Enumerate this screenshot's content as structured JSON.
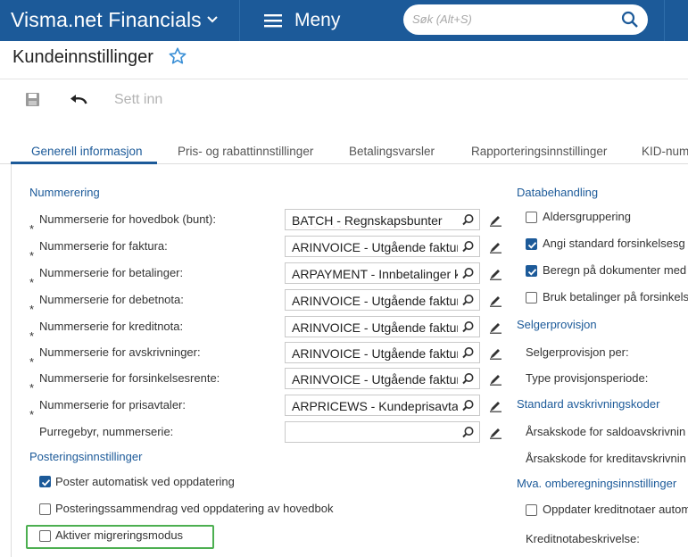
{
  "header": {
    "app_name": "Visma.net Financials",
    "menu_label": "Meny",
    "search_placeholder": "Søk (Alt+S)"
  },
  "page": {
    "title": "Kundeinnstillinger"
  },
  "toolbar": {
    "insert_label": "Sett inn"
  },
  "tabs": [
    {
      "label": "Generell informasjon",
      "active": true
    },
    {
      "label": "Pris- og rabattinnstillinger"
    },
    {
      "label": "Betalingsvarsler"
    },
    {
      "label": "Rapporteringsinnstillinger"
    },
    {
      "label": "KID-num"
    }
  ],
  "numbering": {
    "title": "Nummerering",
    "rows": [
      {
        "label": "Nummerserie for hovedbok (bunt):",
        "value": "BATCH - Regnskapsbunter",
        "required": true
      },
      {
        "label": "Nummerserie for faktura:",
        "value": "ARINVOICE - Utgående faktura",
        "required": true
      },
      {
        "label": "Nummerserie for betalinger:",
        "value": "ARPAYMENT - Innbetalinger ku",
        "required": true
      },
      {
        "label": "Nummerserie for debetnota:",
        "value": "ARINVOICE - Utgående faktura",
        "required": true
      },
      {
        "label": "Nummerserie for kreditnota:",
        "value": "ARINVOICE - Utgående faktura",
        "required": true
      },
      {
        "label": "Nummerserie for avskrivninger:",
        "value": "ARINVOICE - Utgående faktura",
        "required": true
      },
      {
        "label": "Nummerserie for forsinkelsesrente:",
        "value": "ARINVOICE - Utgående faktura",
        "required": true
      },
      {
        "label": "Nummerserie for prisavtaler:",
        "value": "ARPRICEWS - Kundeprisavtale",
        "required": true
      },
      {
        "label": "Purregebyr, nummerserie:",
        "value": "",
        "required": false
      }
    ]
  },
  "posting": {
    "title": "Posteringsinnstillinger",
    "options": [
      {
        "label": "Poster automatisk ved oppdatering",
        "checked": true
      },
      {
        "label": "Posteringssammendrag ved oppdatering av hovedbok",
        "checked": false
      },
      {
        "label": "Aktiver migreringsmodus",
        "checked": false
      }
    ]
  },
  "data_processing": {
    "title": "Databehandling",
    "options": [
      {
        "label": "Aldersgruppering",
        "checked": false
      },
      {
        "label": "Angi standard forsinkelsesg",
        "checked": true
      },
      {
        "label": "Beregn på dokumenter med",
        "checked": true
      },
      {
        "label": "Bruk betalinger på forsinkels",
        "checked": false
      }
    ]
  },
  "salesperson_commission": {
    "title": "Selgerprovisjon",
    "rows": [
      {
        "label": "Selgerprovisjon per:"
      },
      {
        "label": "Type provisjonsperiode:"
      }
    ]
  },
  "write_off_codes": {
    "title": "Standard avskrivningskoder",
    "rows": [
      {
        "label": "Årsakskode for saldoavskrivnin"
      },
      {
        "label": "Årsakskode for kreditavskrivnin"
      }
    ]
  },
  "vat_recalc": {
    "title": "Mva. omberegningsinnstillinger",
    "option": {
      "label": "Oppdater kreditnotaer autom",
      "checked": false
    },
    "row": {
      "label": "Kreditnotabeskrivelse:"
    }
  },
  "colors": {
    "brand": "#1c5a99",
    "highlight": "#4caf50"
  }
}
